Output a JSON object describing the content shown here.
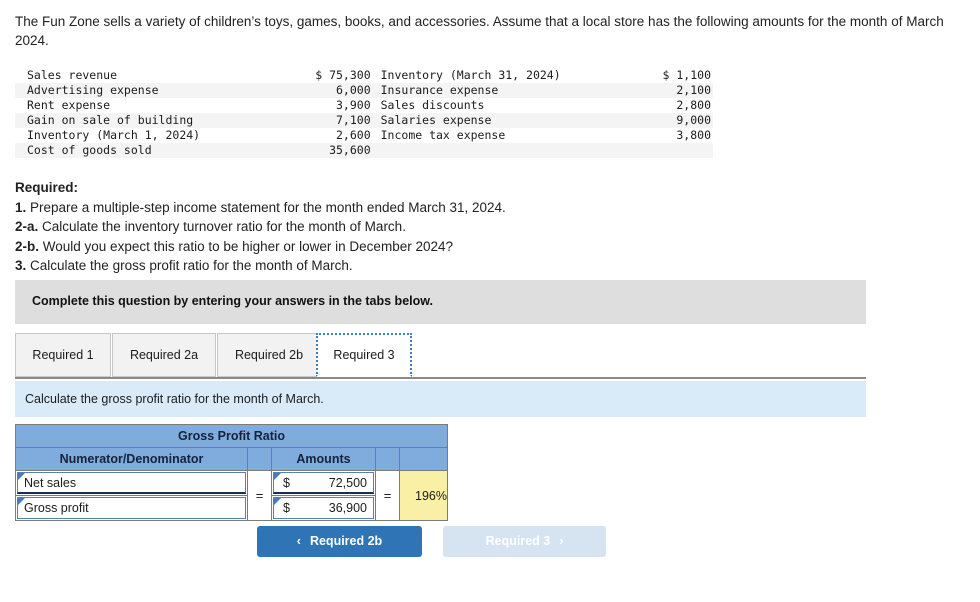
{
  "intro": "The Fun Zone sells a variety of children’s toys, games, books, and accessories. Assume that a local store has the following amounts for the month of March 2024.",
  "amounts": {
    "left_rows": [
      {
        "label": "Sales revenue",
        "value": "$ 75,300"
      },
      {
        "label": "Advertising expense",
        "value": "6,000"
      },
      {
        "label": "Rent expense",
        "value": "3,900"
      },
      {
        "label": "Gain on sale of building",
        "value": "7,100"
      },
      {
        "label": "Inventory (March 1, 2024)",
        "value": "2,600"
      },
      {
        "label": "Cost of goods sold",
        "value": "35,600"
      }
    ],
    "right_rows": [
      {
        "label": "Inventory (March 31, 2024)",
        "value": "$ 1,100"
      },
      {
        "label": "Insurance expense",
        "value": "2,100"
      },
      {
        "label": "Sales discounts",
        "value": "2,800"
      },
      {
        "label": "Salaries expense",
        "value": "9,000"
      },
      {
        "label": "Income tax expense",
        "value": "3,800"
      },
      {
        "label": "",
        "value": ""
      }
    ]
  },
  "required": {
    "heading": "Required:",
    "items": [
      {
        "num": "1.",
        "text": " Prepare a multiple-step income statement for the month ended March 31, 2024."
      },
      {
        "num": "2-a.",
        "text": " Calculate the inventory turnover ratio for the month of March."
      },
      {
        "num": "2-b.",
        "text": " Would you expect this ratio to be higher or lower in December 2024?"
      },
      {
        "num": "3.",
        "text": " Calculate the gross profit ratio for the month of March."
      }
    ]
  },
  "banner": "Complete this question by entering your answers in the tabs below.",
  "tabs": [
    {
      "label": "Required 1",
      "active": false
    },
    {
      "label": "Required 2a",
      "active": false
    },
    {
      "label": "Required 2b",
      "active": false
    },
    {
      "label": "Required 3",
      "active": true
    }
  ],
  "sub_instruction": "Calculate the gross profit ratio for the month of March.",
  "worksheet": {
    "title": "Gross Profit Ratio",
    "col_numerator": "Numerator/Denominator",
    "col_amounts": "Amounts",
    "numerator_label": "Net sales",
    "denominator_label": "Gross profit",
    "numerator_currency": "$",
    "numerator_amount": "72,500",
    "denominator_currency": "$",
    "denominator_amount": "36,900",
    "equals_left": "=",
    "equals_right": "=",
    "result": "196%"
  },
  "nav": {
    "prev_label": "Required 2b",
    "prev_icon": "chevron-left-icon",
    "prev_chevron": "‹",
    "next_label": "Required 3",
    "next_icon": "chevron-right-icon",
    "next_chevron": "›"
  },
  "colors": {
    "header_blue": "#7fabdd",
    "result_yellow": "#faf0a5",
    "info_blue": "#d9ebf9",
    "banner_gray": "#dedede",
    "button_blue": "#2f74b5",
    "button_disabled": "#d6e3f0"
  }
}
